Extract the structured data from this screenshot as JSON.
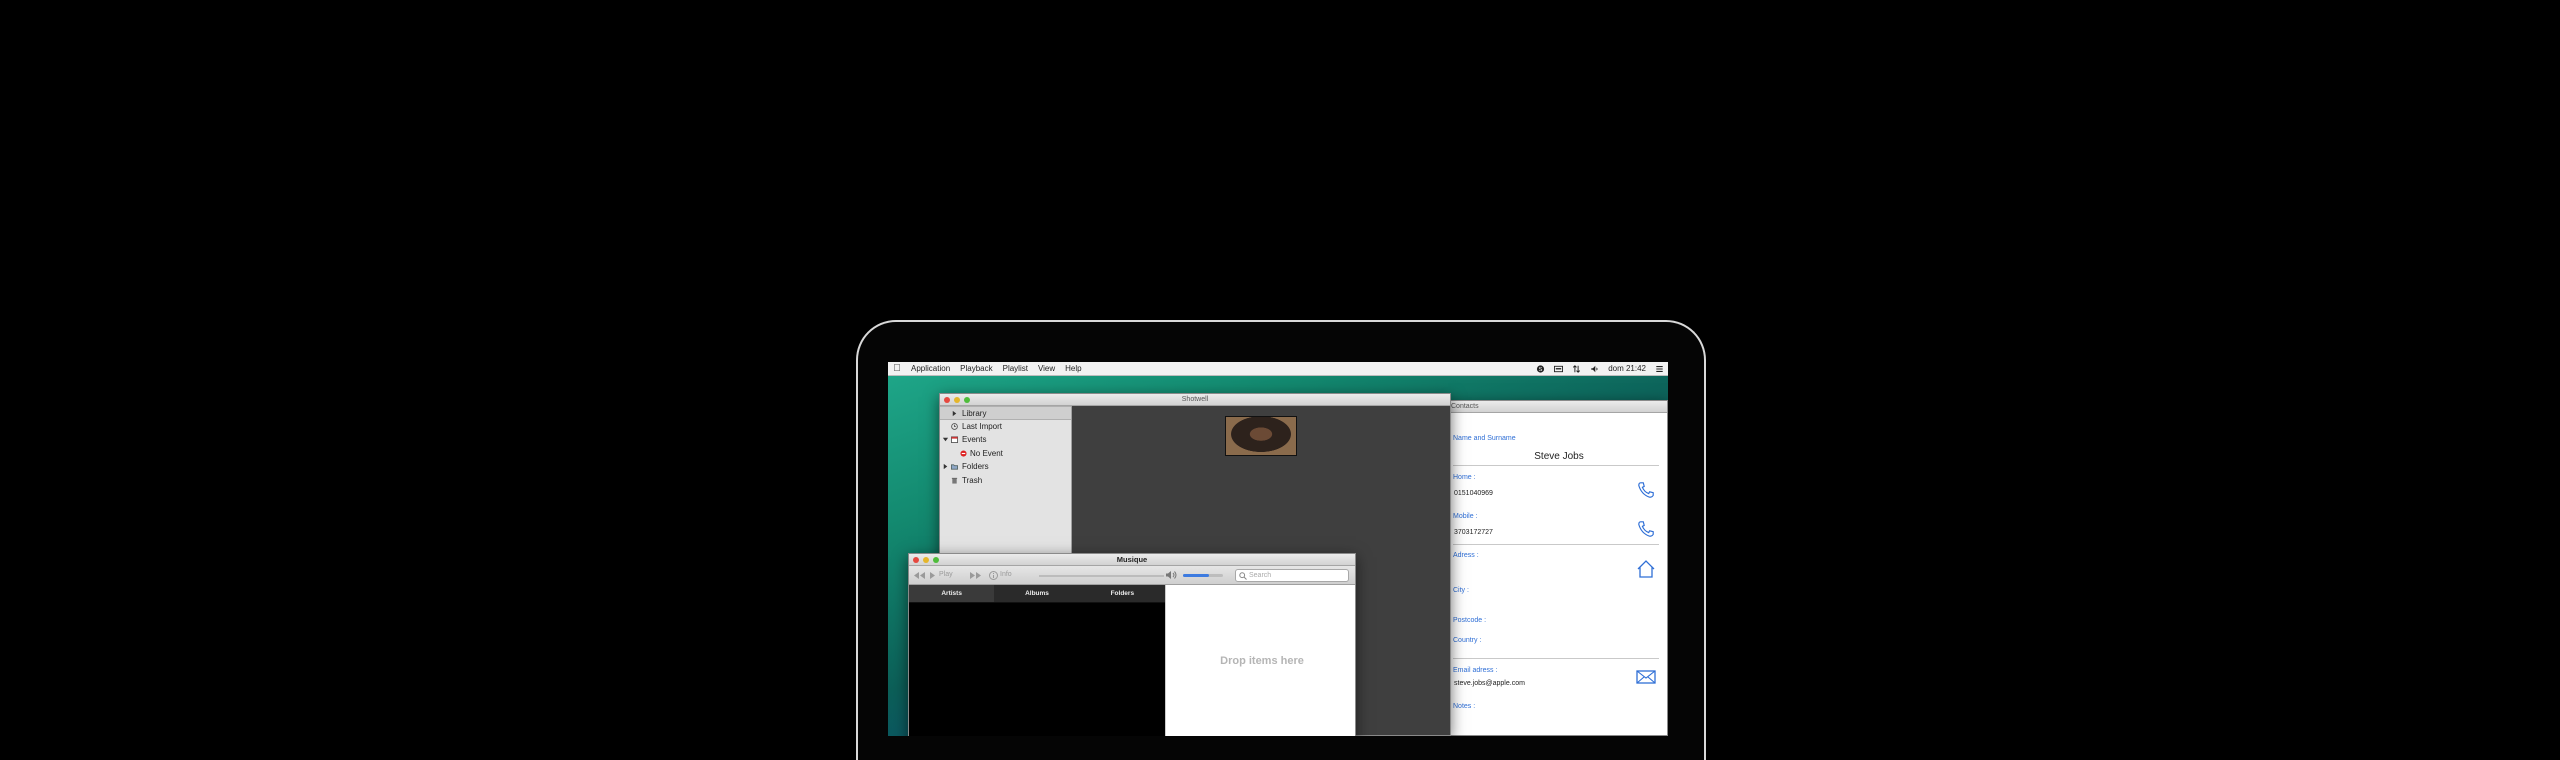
{
  "menubar": {
    "items": [
      "Application",
      "Playback",
      "Playlist",
      "View",
      "Help"
    ],
    "clock": "dom 21:42"
  },
  "shotwell": {
    "title": "Shotwell",
    "sidebar": [
      "Library",
      "Last Import",
      "Events",
      "No Event",
      "Folders",
      "Trash"
    ]
  },
  "contacts": {
    "title": "Contacts",
    "name_label": "Name and Surname",
    "name": "Steve Jobs",
    "home_label": "Home :",
    "home": "0151040969",
    "mobile_label": "Mobile :",
    "mobile": "3703172727",
    "address_label": "Adress :",
    "city_label": "City :",
    "postcode_label": "Postcode :",
    "country_label": "Country :",
    "email_label": "Email adress :",
    "email": "steve.jobs@apple.com",
    "notes_label": "Notes :"
  },
  "musique": {
    "title": "Musique",
    "play_label": "Play",
    "info_label": "Info",
    "search_placeholder": "Search",
    "volume": 0.65,
    "tabs": [
      "Artists",
      "Albums",
      "Folders"
    ],
    "drop_text": "Drop items here"
  },
  "colors": {
    "accent": "#2f6fd6",
    "desktop_top": "#1fa88a",
    "desktop_bottom": "#0d3a8a"
  }
}
